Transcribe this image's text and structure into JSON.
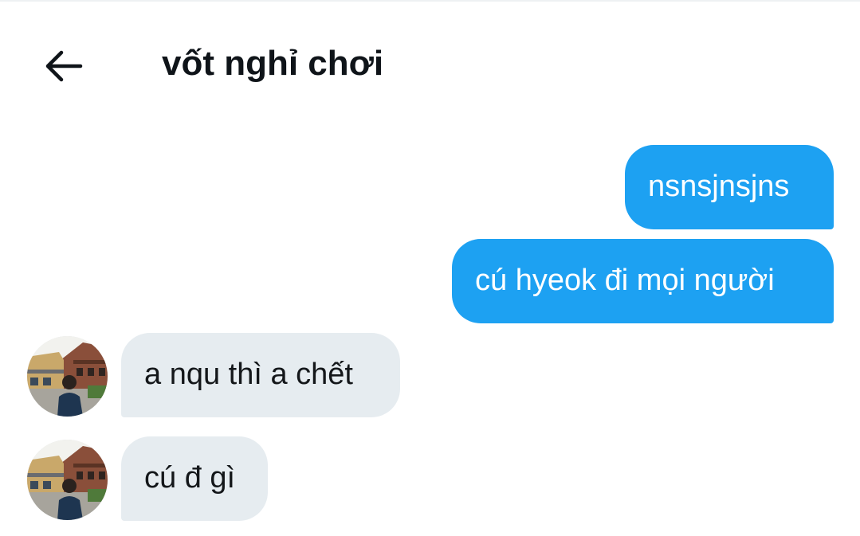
{
  "header": {
    "title": "vốt nghỉ chơi",
    "back_icon": "arrow-left-icon"
  },
  "messages": [
    {
      "direction": "outgoing",
      "text": "nsnsjnsjns"
    },
    {
      "direction": "outgoing",
      "text": "cú hyeok đi mọi người"
    },
    {
      "direction": "incoming",
      "text": "a nqu thì a chết"
    },
    {
      "direction": "incoming",
      "text": "cú đ gì"
    }
  ],
  "colors": {
    "outgoing_bubble": "#1da1f2",
    "incoming_bubble": "#e6ecf0",
    "title_text": "#0f1419"
  }
}
